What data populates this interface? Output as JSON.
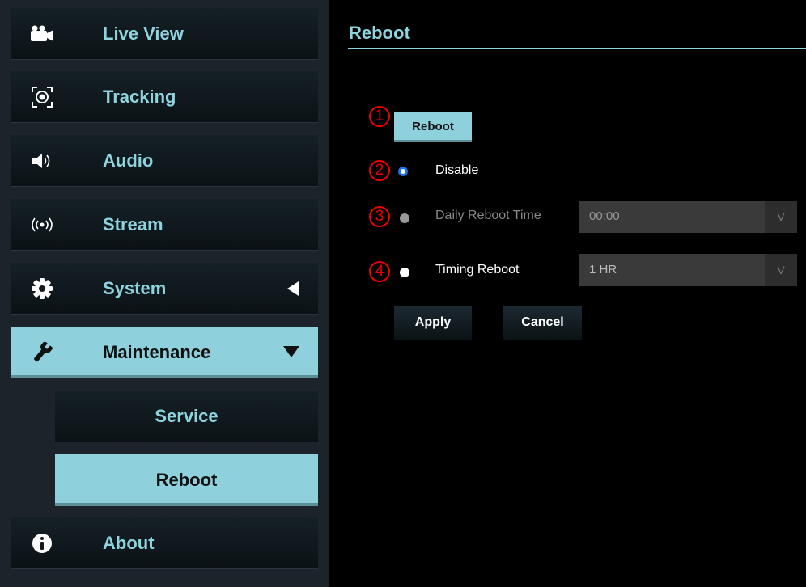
{
  "sidebar": {
    "items": [
      {
        "label": "Live View",
        "icon": "video-camera-icon"
      },
      {
        "label": "Tracking",
        "icon": "tracking-target-icon"
      },
      {
        "label": "Audio",
        "icon": "speaker-icon"
      },
      {
        "label": "Stream",
        "icon": "broadcast-icon"
      },
      {
        "label": "System",
        "icon": "gear-icon"
      },
      {
        "label": "Maintenance",
        "icon": "wrench-icon"
      },
      {
        "label": "About",
        "icon": "info-icon"
      }
    ],
    "subitems": [
      {
        "label": "Service"
      },
      {
        "label": "Reboot"
      }
    ]
  },
  "main": {
    "title": "Reboot",
    "reboot_button": "Reboot",
    "markers": [
      "1",
      "2",
      "3",
      "4"
    ],
    "options": {
      "disable": "Disable",
      "daily": "Daily Reboot Time",
      "timing": "Timing Reboot"
    },
    "daily_time_value": "00:00",
    "timing_value": "1 HR",
    "select_chevron": "V",
    "apply_label": "Apply",
    "cancel_label": "Cancel"
  },
  "colors": {
    "accent": "#8ed0dc",
    "sidebar_bg": "#1c232a",
    "marker_red": "#e00000",
    "radio_blue": "#1a73e8"
  }
}
